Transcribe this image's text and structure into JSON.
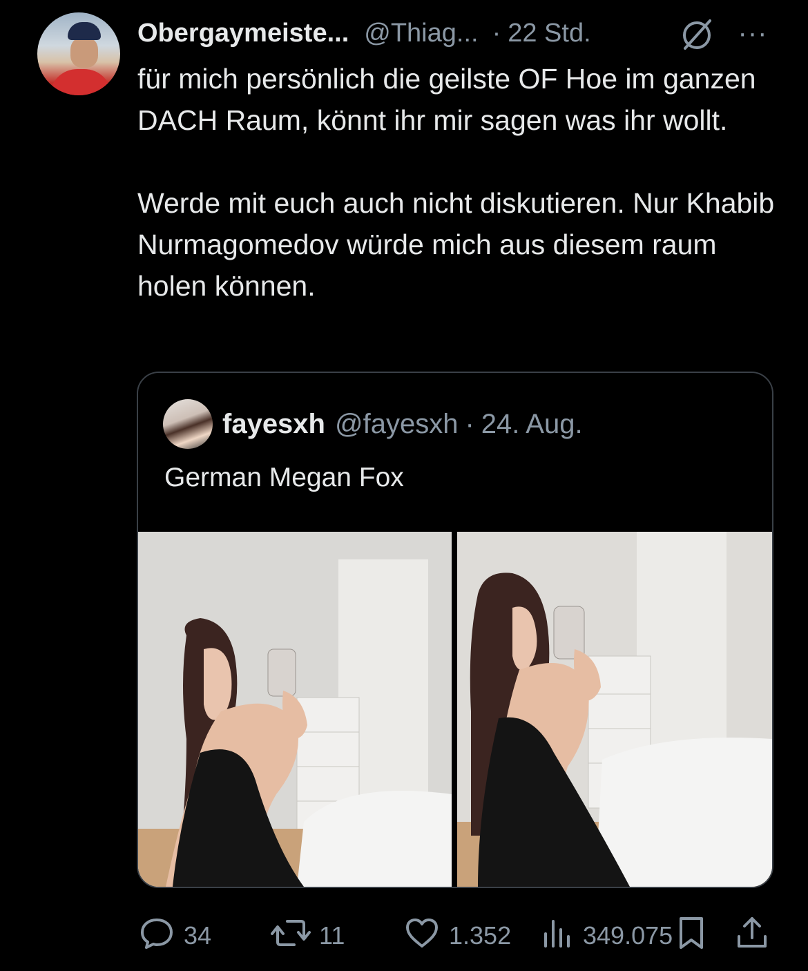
{
  "tweet": {
    "author_name": "Obergaymeiste...",
    "handle": "@Thiag...",
    "separator": "·",
    "time": "22 Std.",
    "more_label": "···",
    "text_paragraphs": [
      "für mich persönlich die geilste OF Hoe im ganzen DACH Raum, könnt ihr mir sagen was ihr wollt.",
      "Werde mit euch auch nicht diskutieren. Nur Khabib Nurmagomedov würde mich aus diesem raum holen können."
    ]
  },
  "quoted": {
    "author_name": "fayesxh",
    "handle": "@fayesxh",
    "separator": "·",
    "time": "24. Aug.",
    "text": "German Megan Fox",
    "media_count": 2
  },
  "actions": {
    "replies": "34",
    "reposts": "11",
    "likes": "1.352",
    "views": "349.075"
  },
  "icons": {
    "avatar": "user-avatar",
    "grok": "slash-circle-icon",
    "more": "more-dots-icon",
    "reply": "reply-bubble-icon",
    "repost": "repost-arrows-icon",
    "like": "heart-icon",
    "views": "views-bar-icon",
    "bookmark": "bookmark-icon",
    "share": "share-icon"
  },
  "colors": {
    "background": "#000000",
    "text": "#e7e9ea",
    "muted": "#8b98a5",
    "border": "#3a4047"
  }
}
